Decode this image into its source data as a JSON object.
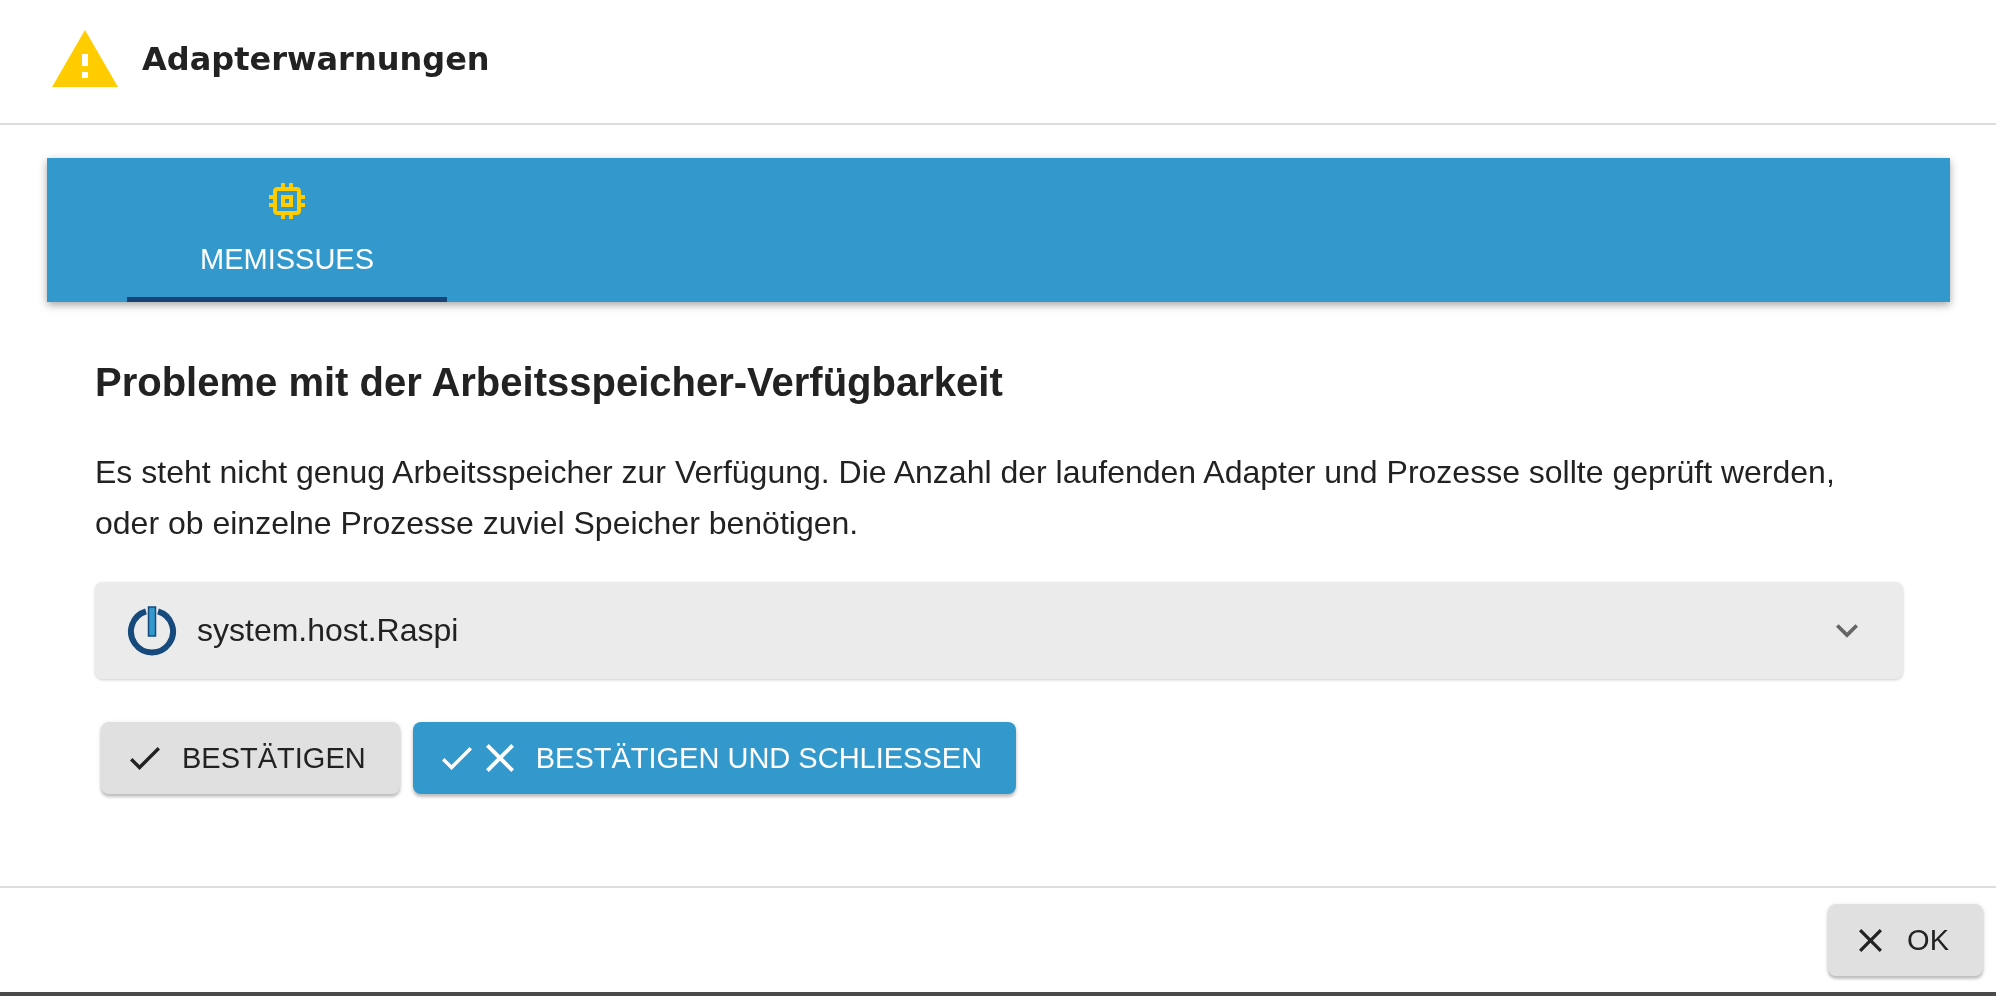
{
  "dialog": {
    "title": "Adapterwarnungen"
  },
  "tabs": [
    {
      "label": "MEMISSUES",
      "selected": true
    }
  ],
  "section": {
    "heading": "Probleme mit der Arbeitsspeicher-Verfügbarkeit",
    "description": "Es steht nicht genug Arbeitsspeicher zur Verfügung. Die Anzahl der laufenden Adapter und Prozesse sollte geprüft werden, oder ob einzelne Prozesse zuviel Speicher benötigen."
  },
  "accordion": [
    {
      "label": "system.host.Raspi",
      "expanded": false
    }
  ],
  "actions": [
    {
      "label": "BESTÄTIGEN",
      "kind": "acknowledge"
    },
    {
      "label": "BESTÄTIGEN UND SCHLIESSEN",
      "kind": "acknowledge-close"
    }
  ],
  "footer": {
    "buttons": [
      {
        "label": "OK",
        "kind": "close"
      }
    ]
  }
}
